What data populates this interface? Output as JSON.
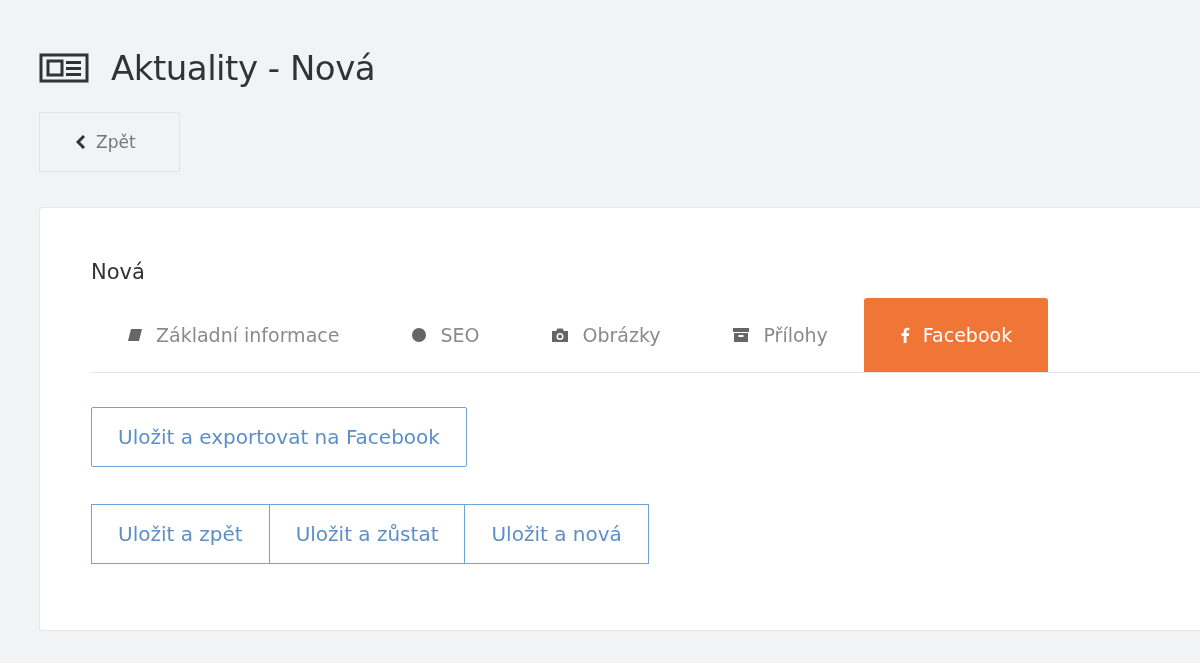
{
  "page": {
    "title": "Aktuality - Nová"
  },
  "back_button": {
    "label": "Zpět"
  },
  "card": {
    "heading": "Nová",
    "tabs": [
      {
        "label": "Základní informace",
        "selected": false
      },
      {
        "label": "SEO",
        "selected": false
      },
      {
        "label": "Obrázky",
        "selected": false
      },
      {
        "label": "Přílohy",
        "selected": false
      },
      {
        "label": "Facebook",
        "selected": true
      }
    ],
    "export_button": "Uložit a exportovat na Facebook",
    "save_buttons": [
      "Uložit a zpět",
      "Uložit a zůstat",
      "Uložit a nová"
    ]
  }
}
